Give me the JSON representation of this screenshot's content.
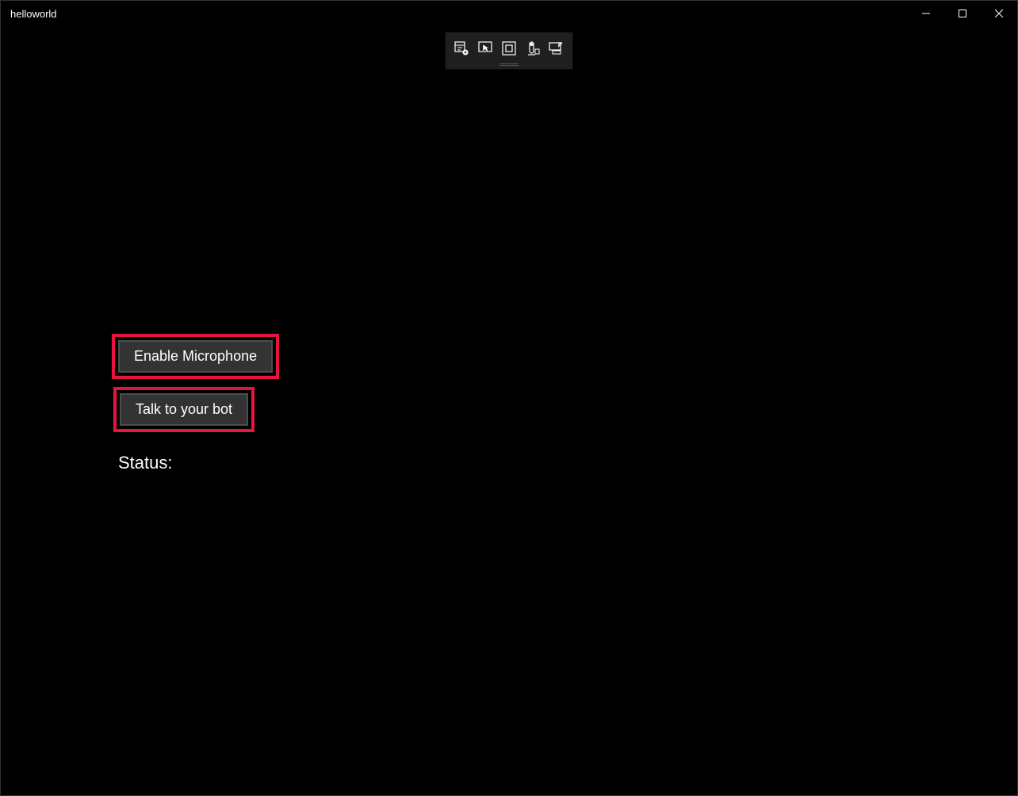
{
  "window": {
    "title": "helloworld"
  },
  "debug_toolbar": {
    "icons": [
      "go-to-live-visual-tree-icon",
      "enable-selection-icon",
      "display-layout-adorners-icon",
      "track-focused-element-icon",
      "hot-reload-icon"
    ]
  },
  "buttons": {
    "enable_microphone": "Enable Microphone",
    "talk_to_bot": "Talk to your bot"
  },
  "status": {
    "label": "Status:"
  },
  "highlight_color": "#e91340"
}
